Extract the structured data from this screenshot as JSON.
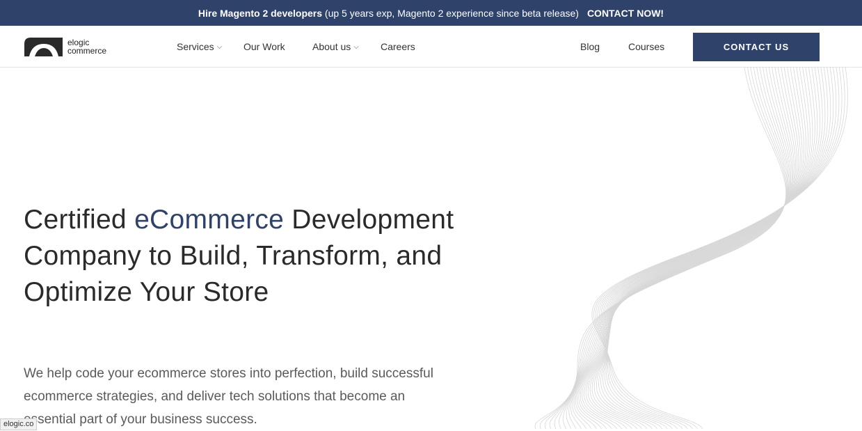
{
  "announcement": {
    "strong": "Hire Magento 2 developers",
    "text": " (up 5 years exp, Magento 2 experience since beta release)",
    "cta": "CONTACT NOW!"
  },
  "logo": {
    "line1": "elogic",
    "line2": "commerce"
  },
  "nav": {
    "services": "Services",
    "our_work": "Our Work",
    "about": "About us",
    "careers": "Careers",
    "blog": "Blog",
    "courses": "Courses",
    "contact": "CONTACT US"
  },
  "icons": {
    "dropdown": "chevron-down-icon",
    "logo": "arc-logo-icon"
  },
  "colors": {
    "brand": "#2f426a",
    "text": "#2a2a2a",
    "muted": "#5a5a5a"
  },
  "hero": {
    "title_pre": "Certified ",
    "title_accent": "eCommerce",
    "title_post": " Development Company to Build, Transform, and Optimize Your Store",
    "subtitle": "We help code your ecommerce stores into perfection, build successful ecommerce strategies, and deliver tech solutions that become an essential part of your business success."
  },
  "status_url": "elogic.co"
}
